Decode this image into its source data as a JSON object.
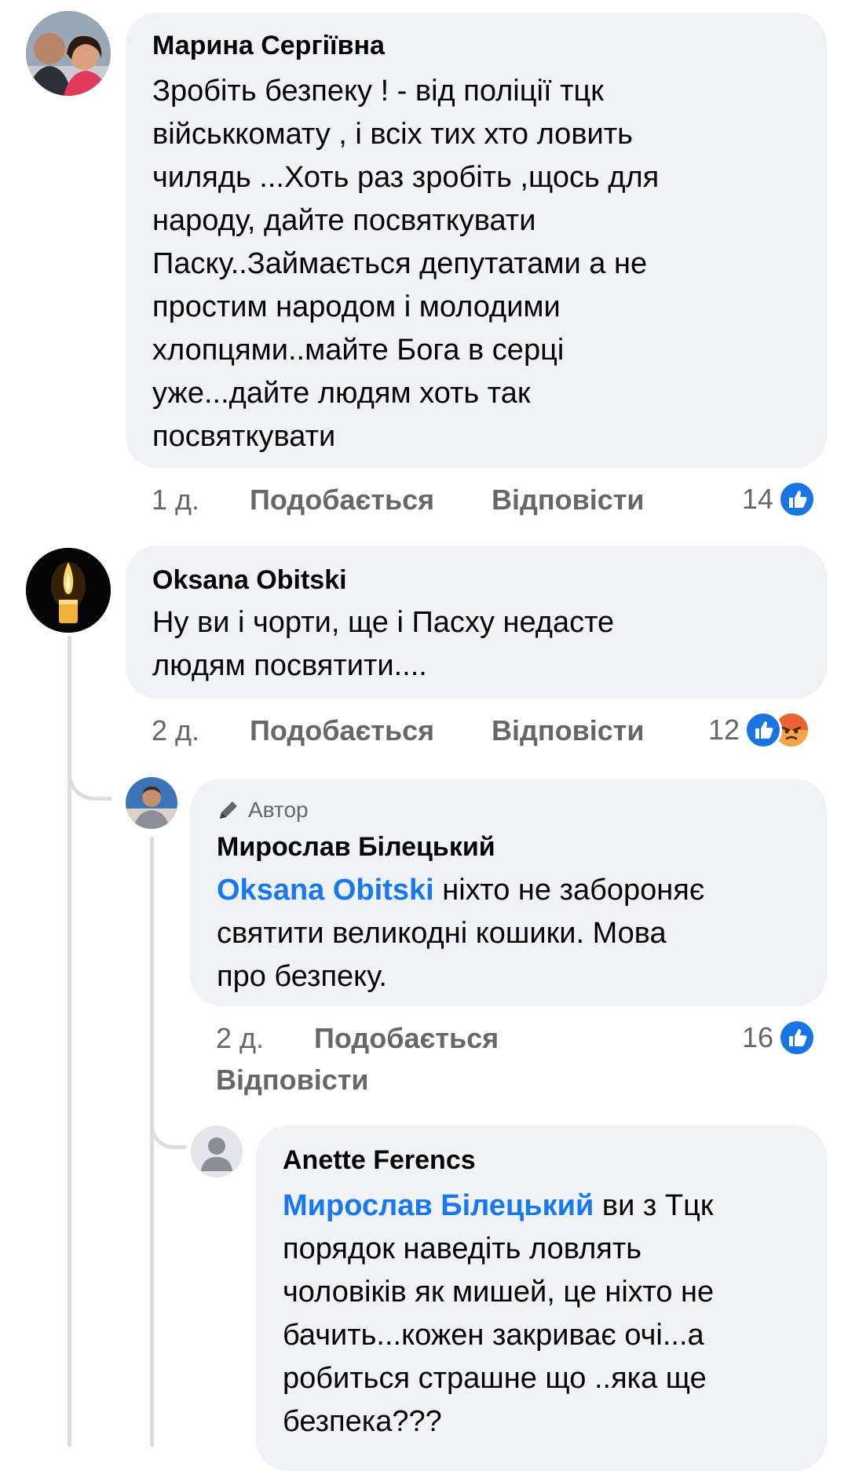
{
  "comments": [
    {
      "author": "Марина Сергіївна",
      "text": "Зробіть безпеку  ! - від поліції тцк\nвійськкомату , і всіх тих хто ловить\nчилядь ...Хоть раз зробіть ,щось для\nнароду, дайте посвяткувати\nПаску..Займається депутатами а не\nпростим народом і молодими\nхлопцями..майте Бога в серці\nуже...дайте людям хоть так\nпосвяткувати",
      "time": "1 д.",
      "like_label": "Подобається",
      "reply_label": "Відповісти",
      "reactions_count": "14"
    },
    {
      "author": "Oksana Obitski",
      "text": "Ну ви і чорти, ще і Пасху недасте\nлюдям посвятити....",
      "time": "2 д.",
      "like_label": "Подобається",
      "reply_label": "Відповісти",
      "reactions_count": "12",
      "replies": [
        {
          "badge": "Автор",
          "author": "Мирослав Білецький",
          "mention": "Oksana Obitski",
          "text": " ніхто не забороняє\nсвятити великодні кошики. Мова\nпро безпеку.",
          "time": "2 д.",
          "like_label": "Подобається",
          "reply_label": "Відповісти",
          "reactions_count": "16"
        },
        {
          "author": "Anette Ferencs",
          "mention": "Мирослав Білецький",
          "text": " ви з Тцк\nпорядок наведіть ловлять\nчоловіків як мишей, це ніхто не\nбачить...кожен закриває очі...а\nробиться страшне що ..яка ще\nбезпека???"
        }
      ]
    }
  ],
  "colors": {
    "bubble": "#f0f2f5",
    "meta_text": "#65676b",
    "mention": "#1877f2",
    "like_reaction": "#1b74e4",
    "angry_reaction": "#f27a2c",
    "thread_line": "#dcdde1"
  }
}
